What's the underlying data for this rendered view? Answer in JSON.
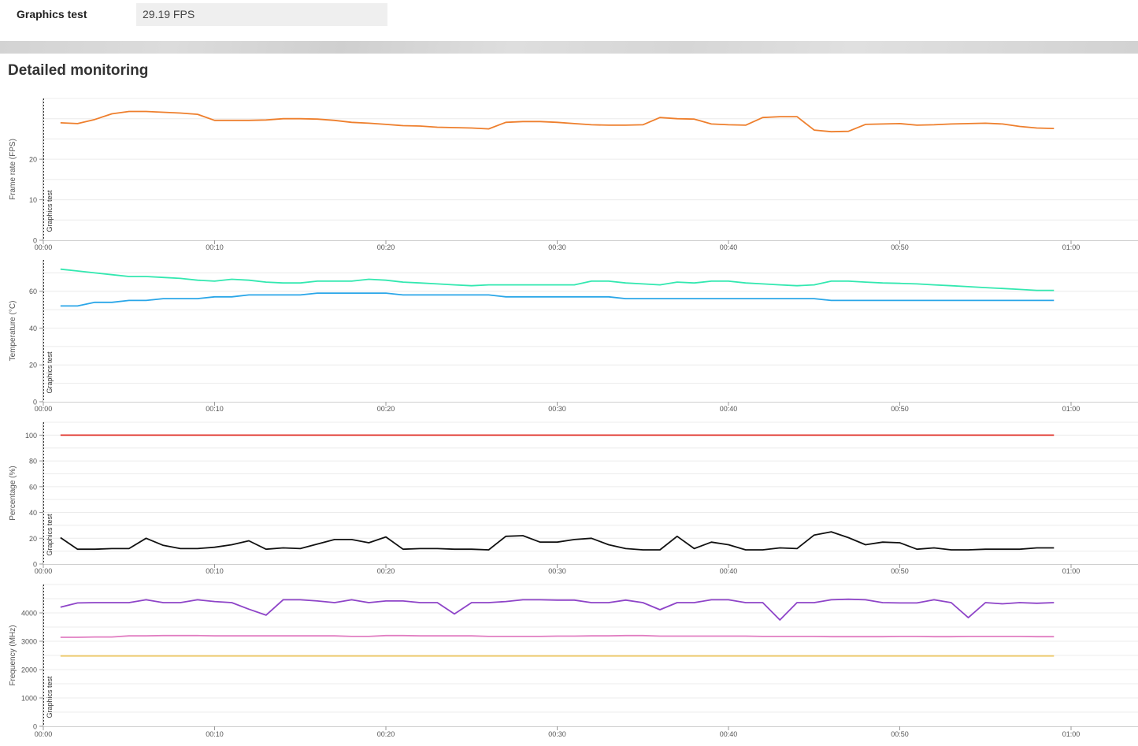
{
  "result": {
    "label": "Graphics test",
    "value": "29.19 FPS"
  },
  "section_title": "Detailed monitoring",
  "marker_label": "Graphics test",
  "chart_data": [
    {
      "type": "line",
      "ylabel": "Frame rate (FPS)",
      "xlabel": "",
      "xlim": [
        0,
        60
      ],
      "ylim": [
        0,
        35
      ],
      "yticks": [
        0,
        10,
        20
      ],
      "xticks": [
        "00:00",
        "00:10",
        "00:20",
        "00:30",
        "00:40",
        "00:50",
        "01:00"
      ],
      "series": [
        {
          "color": "#ee7f2d",
          "x": [
            1,
            2,
            3,
            4,
            5,
            6,
            7,
            8,
            9,
            10,
            11,
            12,
            13,
            14,
            15,
            16,
            17,
            18,
            19,
            20,
            21,
            22,
            23,
            24,
            25,
            26,
            27,
            28,
            29,
            30,
            31,
            32,
            33,
            34,
            35,
            36,
            37,
            38,
            39,
            40,
            41,
            42,
            43,
            44,
            45,
            46,
            47,
            48,
            49,
            50,
            51,
            52,
            53,
            54,
            55,
            56,
            57,
            58,
            59
          ],
          "y": [
            29.0,
            28.8,
            29.8,
            31.2,
            31.8,
            31.8,
            31.6,
            31.4,
            31.1,
            29.6,
            29.6,
            29.6,
            29.7,
            30.0,
            30.0,
            29.9,
            29.6,
            29.1,
            28.9,
            28.6,
            28.3,
            28.2,
            27.9,
            27.8,
            27.7,
            27.5,
            29.1,
            29.3,
            29.3,
            29.1,
            28.8,
            28.5,
            28.4,
            28.4,
            28.5,
            30.3,
            30.0,
            29.9,
            28.7,
            28.5,
            28.4,
            30.3,
            30.5,
            30.5,
            27.2,
            26.8,
            26.9,
            28.6,
            28.7,
            28.8,
            28.4,
            28.5,
            28.7,
            28.8,
            28.9,
            28.7,
            28.1,
            27.7,
            27.6
          ]
        }
      ]
    },
    {
      "type": "line",
      "ylabel": "Temperature (°C)",
      "xlabel": "",
      "xlim": [
        0,
        60
      ],
      "ylim": [
        0,
        77
      ],
      "yticks": [
        0,
        20,
        40,
        60
      ],
      "xticks": [
        "00:00",
        "00:10",
        "00:20",
        "00:30",
        "00:40",
        "00:50",
        "01:00"
      ],
      "series": [
        {
          "color": "#33e8b0",
          "x": [
            1,
            2,
            3,
            4,
            5,
            6,
            7,
            8,
            9,
            10,
            11,
            12,
            13,
            14,
            15,
            16,
            17,
            18,
            19,
            20,
            21,
            22,
            23,
            24,
            25,
            26,
            27,
            28,
            29,
            30,
            31,
            32,
            33,
            34,
            35,
            36,
            37,
            38,
            39,
            40,
            41,
            42,
            43,
            44,
            45,
            46,
            47,
            48,
            49,
            50,
            51,
            52,
            53,
            54,
            55,
            56,
            57,
            58,
            59
          ],
          "y": [
            72,
            71,
            70,
            69,
            68,
            68,
            67.5,
            67,
            66,
            65.5,
            66.5,
            66,
            65,
            64.5,
            64.5,
            65.5,
            65.5,
            65.5,
            66.5,
            66,
            65,
            64.5,
            64,
            63.5,
            63,
            63.5,
            63.5,
            63.5,
            63.5,
            63.5,
            63.5,
            65.5,
            65.5,
            64.5,
            64,
            63.5,
            65,
            64.5,
            65.5,
            65.5,
            64.5,
            64,
            63.5,
            63,
            63.5,
            65.5,
            65.5,
            65,
            64.5,
            64.3,
            64,
            63.5,
            63,
            62.5,
            62,
            61.5,
            61,
            60.5,
            60.5
          ]
        },
        {
          "color": "#2aa6e8",
          "x": [
            1,
            2,
            3,
            4,
            5,
            6,
            7,
            8,
            9,
            10,
            11,
            12,
            13,
            14,
            15,
            16,
            17,
            18,
            19,
            20,
            21,
            22,
            23,
            24,
            25,
            26,
            27,
            28,
            29,
            30,
            31,
            32,
            33,
            34,
            35,
            36,
            37,
            38,
            39,
            40,
            41,
            42,
            43,
            44,
            45,
            46,
            47,
            48,
            49,
            50,
            51,
            52,
            53,
            54,
            55,
            56,
            57,
            58,
            59
          ],
          "y": [
            52,
            52,
            54,
            54,
            55,
            55,
            56,
            56,
            56,
            57,
            57,
            58,
            58,
            58,
            58,
            59,
            59,
            59,
            59,
            59,
            58,
            58,
            58,
            58,
            58,
            58,
            57,
            57,
            57,
            57,
            57,
            57,
            57,
            56,
            56,
            56,
            56,
            56,
            56,
            56,
            56,
            56,
            56,
            56,
            56,
            55,
            55,
            55,
            55,
            55,
            55,
            55,
            55,
            55,
            55,
            55,
            55,
            55,
            55
          ]
        }
      ]
    },
    {
      "type": "line",
      "ylabel": "Percentage (%)",
      "xlabel": "",
      "xlim": [
        0,
        60
      ],
      "ylim": [
        0,
        110
      ],
      "yticks": [
        0,
        20,
        40,
        60,
        80,
        100
      ],
      "xticks": [
        "00:00",
        "00:10",
        "00:20",
        "00:30",
        "00:40",
        "00:50",
        "01:00"
      ],
      "series": [
        {
          "color": "#e0332a",
          "x": [
            1,
            59
          ],
          "y": [
            100,
            100
          ]
        },
        {
          "color": "#111111",
          "x": [
            1,
            2,
            3,
            4,
            5,
            6,
            7,
            8,
            9,
            10,
            11,
            12,
            13,
            14,
            15,
            16,
            17,
            18,
            19,
            20,
            21,
            22,
            23,
            24,
            25,
            26,
            27,
            28,
            29,
            30,
            31,
            32,
            33,
            34,
            35,
            36,
            37,
            38,
            39,
            40,
            41,
            42,
            43,
            44,
            45,
            46,
            47,
            48,
            49,
            50,
            51,
            52,
            53,
            54,
            55,
            56,
            57,
            58,
            59
          ],
          "y": [
            20.5,
            11.5,
            11.5,
            12,
            12,
            20,
            14.5,
            12,
            12,
            13,
            15,
            18,
            11.5,
            12.5,
            12,
            15.5,
            19,
            19,
            16.5,
            21,
            11.5,
            12,
            12,
            11.5,
            11.5,
            11,
            21.5,
            22,
            17,
            17,
            19,
            20,
            15,
            12,
            11,
            11,
            21.5,
            12,
            17,
            15,
            11,
            11,
            12.5,
            12,
            22.5,
            25,
            20.5,
            15,
            17,
            16.5,
            11.5,
            12.5,
            11,
            11,
            11.5,
            11.5,
            11.5,
            12.5,
            12.5
          ]
        }
      ]
    },
    {
      "type": "line",
      "ylabel": "Frequency (MHz)",
      "xlabel": "",
      "xlim": [
        0,
        60
      ],
      "ylim": [
        0,
        5000
      ],
      "yticks": [
        0,
        1000,
        2000,
        3000,
        4000
      ],
      "xticks": [
        "00:00",
        "00:10",
        "00:20",
        "00:30",
        "00:40",
        "00:50",
        "01:00"
      ],
      "series": [
        {
          "color": "#8e44c8",
          "x": [
            1,
            2,
            3,
            4,
            5,
            6,
            7,
            8,
            9,
            10,
            11,
            12,
            13,
            14,
            15,
            16,
            17,
            18,
            19,
            20,
            21,
            22,
            23,
            24,
            25,
            26,
            27,
            28,
            29,
            30,
            31,
            32,
            33,
            34,
            35,
            36,
            37,
            38,
            39,
            40,
            41,
            42,
            43,
            44,
            45,
            46,
            47,
            48,
            49,
            50,
            51,
            52,
            53,
            54,
            55,
            56,
            57,
            58,
            59
          ],
          "y": [
            4200,
            4350,
            4360,
            4360,
            4360,
            4460,
            4360,
            4360,
            4460,
            4400,
            4360,
            4130,
            3920,
            4460,
            4460,
            4420,
            4360,
            4460,
            4360,
            4420,
            4420,
            4360,
            4360,
            3960,
            4360,
            4360,
            4400,
            4460,
            4460,
            4450,
            4450,
            4360,
            4360,
            4450,
            4360,
            4110,
            4360,
            4360,
            4460,
            4460,
            4360,
            4360,
            3750,
            4360,
            4360,
            4460,
            4480,
            4460,
            4360,
            4350,
            4350,
            4460,
            4360,
            3830,
            4360,
            4320,
            4360,
            4340,
            4360
          ]
        },
        {
          "color": "#e17ec2",
          "x": [
            1,
            2,
            3,
            4,
            5,
            6,
            7,
            8,
            9,
            10,
            11,
            12,
            13,
            14,
            15,
            16,
            17,
            18,
            19,
            20,
            21,
            22,
            23,
            24,
            25,
            26,
            27,
            28,
            29,
            30,
            31,
            32,
            33,
            34,
            35,
            36,
            37,
            38,
            39,
            40,
            41,
            42,
            43,
            44,
            45,
            46,
            47,
            48,
            49,
            50,
            51,
            52,
            53,
            54,
            55,
            56,
            57,
            58,
            59
          ],
          "y": [
            3140,
            3140,
            3150,
            3150,
            3190,
            3190,
            3200,
            3200,
            3200,
            3190,
            3190,
            3190,
            3190,
            3190,
            3190,
            3190,
            3190,
            3170,
            3170,
            3200,
            3200,
            3190,
            3190,
            3190,
            3190,
            3170,
            3170,
            3170,
            3170,
            3180,
            3180,
            3190,
            3190,
            3200,
            3200,
            3180,
            3180,
            3180,
            3180,
            3180,
            3180,
            3170,
            3170,
            3170,
            3170,
            3160,
            3160,
            3160,
            3160,
            3170,
            3170,
            3160,
            3160,
            3170,
            3170,
            3170,
            3170,
            3160,
            3160
          ]
        },
        {
          "color": "#edc96a",
          "x": [
            1,
            59
          ],
          "y": [
            2480,
            2480
          ]
        }
      ]
    }
  ]
}
